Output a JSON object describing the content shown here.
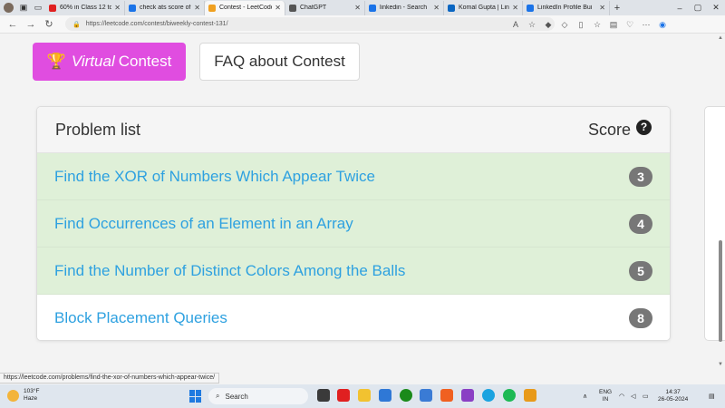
{
  "browser": {
    "tabs": [
      {
        "title": "60% in Class 12 to",
        "favicon_color": "#e02020"
      },
      {
        "title": "check ats score of r",
        "favicon_color": "#1a73e8"
      },
      {
        "title": "Contest - LeetCode",
        "favicon_color": "#f0a020"
      },
      {
        "title": "ChatGPT",
        "favicon_color": "#555555"
      },
      {
        "title": "linkedin - Search",
        "favicon_color": "#1a73e8"
      },
      {
        "title": "Komal Gupta | Linke",
        "favicon_color": "#0a66c2"
      },
      {
        "title": "LinkedIn Profile Bui",
        "favicon_color": "#1a73e8"
      }
    ],
    "active_tab_index": 2,
    "url": "https://leetcode.com/contest/biweekly-contest-131/",
    "status_url": "https://leetcode.com/problems/find-the-xor-of-numbers-which-appear-twice/"
  },
  "contest": {
    "virtual_button": {
      "prefix": "Virtual",
      "suffix": "Contest"
    },
    "faq_button": "FAQ about Contest",
    "problem_list_header": "Problem list",
    "score_header": "Score",
    "help_icon_glyph": "?",
    "problems": [
      {
        "title": "Find the XOR of Numbers Which Appear Twice",
        "score": "3",
        "solved": true
      },
      {
        "title": "Find Occurrences of an Element in an Array",
        "score": "4",
        "solved": true
      },
      {
        "title": "Find the Number of Distinct Colors Among the Balls",
        "score": "5",
        "solved": true
      },
      {
        "title": "Block Placement Queries",
        "score": "8",
        "solved": false
      }
    ],
    "colors": {
      "virtual_button": "#e04de0",
      "solved_row": "#dff0d8",
      "link": "#2ea1e0",
      "badge": "#777777"
    }
  },
  "taskbar": {
    "weather_temp": "103°F",
    "weather_desc": "Haze",
    "search_label": "Search",
    "lang_line1": "ENG",
    "lang_line2": "IN",
    "time": "14:37",
    "date": "26-05-2024"
  }
}
